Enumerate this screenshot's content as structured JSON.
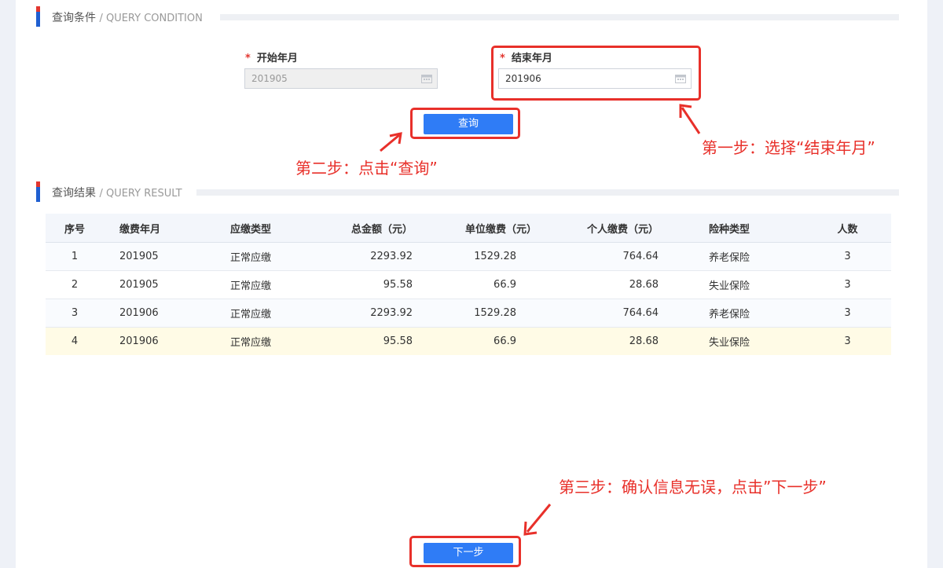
{
  "query_section": {
    "title_cn": "查询条件",
    "title_en": "/ QUERY CONDITION"
  },
  "result_section": {
    "title_cn": "查询结果",
    "title_en": "/ QUERY RESULT"
  },
  "form": {
    "start": {
      "label": "开始年月",
      "value": "201905",
      "required_mark": "*"
    },
    "end": {
      "label": "结束年月",
      "value": "201906",
      "required_mark": "*"
    },
    "query_button": "查询"
  },
  "annotations": {
    "step1": "第一步：选择“结束年月”",
    "step2": "第二步：点击“查询”",
    "step3": "第三步：确认信息无误，点击”下一步”"
  },
  "table": {
    "headers": [
      "序号",
      "缴费年月",
      "应缴类型",
      "总金额（元）",
      "单位缴费（元）",
      "个人缴费（元）",
      "险种类型",
      "人数"
    ],
    "rows": [
      [
        "1",
        "201905",
        "正常应缴",
        "2293.92",
        "1529.28",
        "764.64",
        "养老保险",
        "3"
      ],
      [
        "2",
        "201905",
        "正常应缴",
        "95.58",
        "66.9",
        "28.68",
        "失业保险",
        "3"
      ],
      [
        "3",
        "201906",
        "正常应缴",
        "2293.92",
        "1529.28",
        "764.64",
        "养老保险",
        "3"
      ],
      [
        "4",
        "201906",
        "正常应缴",
        "95.58",
        "66.9",
        "28.68",
        "失业保险",
        "3"
      ]
    ]
  },
  "next_button": "下一步",
  "colors": {
    "primary": "#2f7cf6",
    "annotation": "#e8302a",
    "accent_blue": "#1f5fd1",
    "highlight_row": "#fffbe6"
  },
  "icons": {
    "date_picker": "calendar-icon"
  }
}
